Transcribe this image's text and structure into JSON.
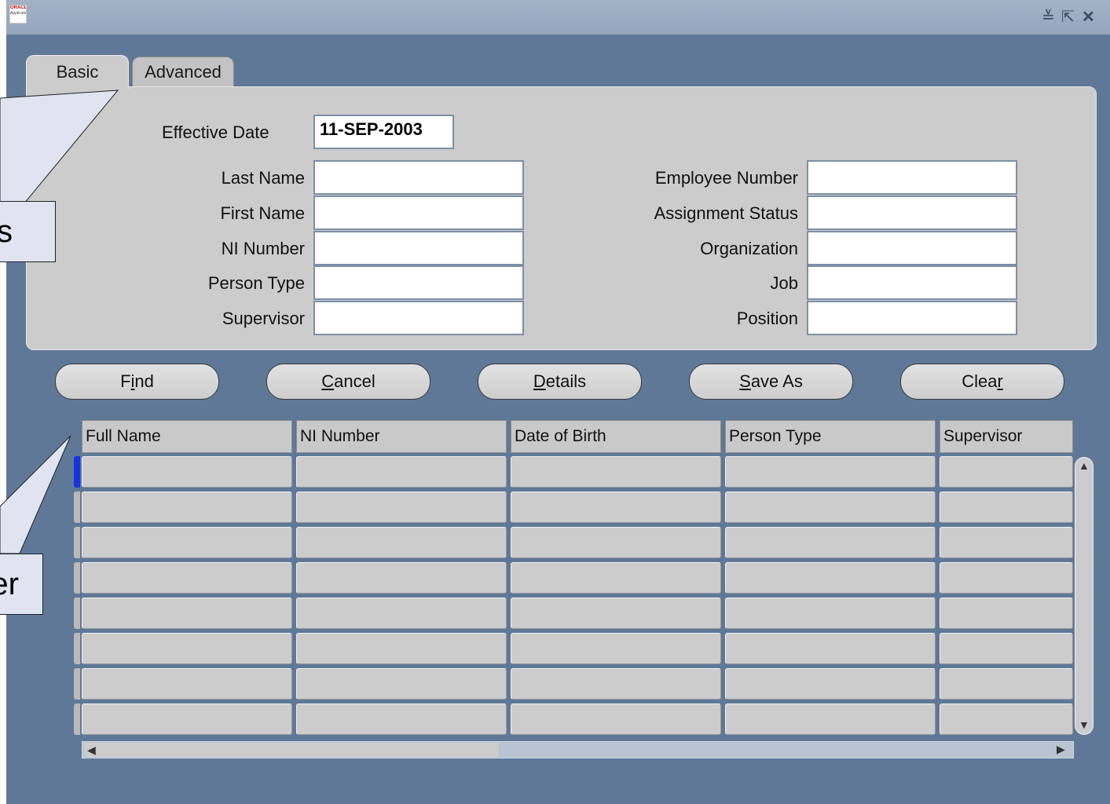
{
  "window": {
    "logo_text": "ORACLE",
    "logo_sub": "Applications",
    "controls": {
      "minimize": "≚",
      "maximize": "⇱",
      "close": "✕"
    }
  },
  "tabs": [
    {
      "label": "Basic",
      "active": true
    },
    {
      "label": "Advanced",
      "active": false
    }
  ],
  "form": {
    "effective_date_label": "Effective Date",
    "effective_date_value": "11-SEP-2003",
    "left_fields": [
      {
        "label": "Last Name",
        "value": ""
      },
      {
        "label": "First Name",
        "value": ""
      },
      {
        "label": "NI Number",
        "value": ""
      },
      {
        "label": "Person Type",
        "value": ""
      },
      {
        "label": "Supervisor",
        "value": ""
      }
    ],
    "right_fields": [
      {
        "label": "Employee Number",
        "value": ""
      },
      {
        "label": "Assignment Status",
        "value": ""
      },
      {
        "label": "Organization",
        "value": ""
      },
      {
        "label": "Job",
        "value": ""
      },
      {
        "label": "Position",
        "value": ""
      }
    ]
  },
  "buttons": [
    {
      "label": "Find",
      "mnemonic": "i"
    },
    {
      "label": "Cancel",
      "mnemonic": "C"
    },
    {
      "label": "Details",
      "mnemonic": "D"
    },
    {
      "label": "Save As",
      "mnemonic": "S"
    },
    {
      "label": "Clear",
      "mnemonic": "r"
    }
  ],
  "results": {
    "columns": [
      "Full Name",
      "NI Number",
      "Date of Birth",
      "Person Type",
      "Supervisor"
    ],
    "row_count": 8,
    "active_row": 1
  },
  "callouts": [
    {
      "text": "s"
    },
    {
      "text": "er"
    }
  ],
  "colors": {
    "window_bg": "#5f7898",
    "panel_bg": "#cccccc",
    "active_row_marker": "#1533e0",
    "callout_bg": "#dfe4f0"
  }
}
